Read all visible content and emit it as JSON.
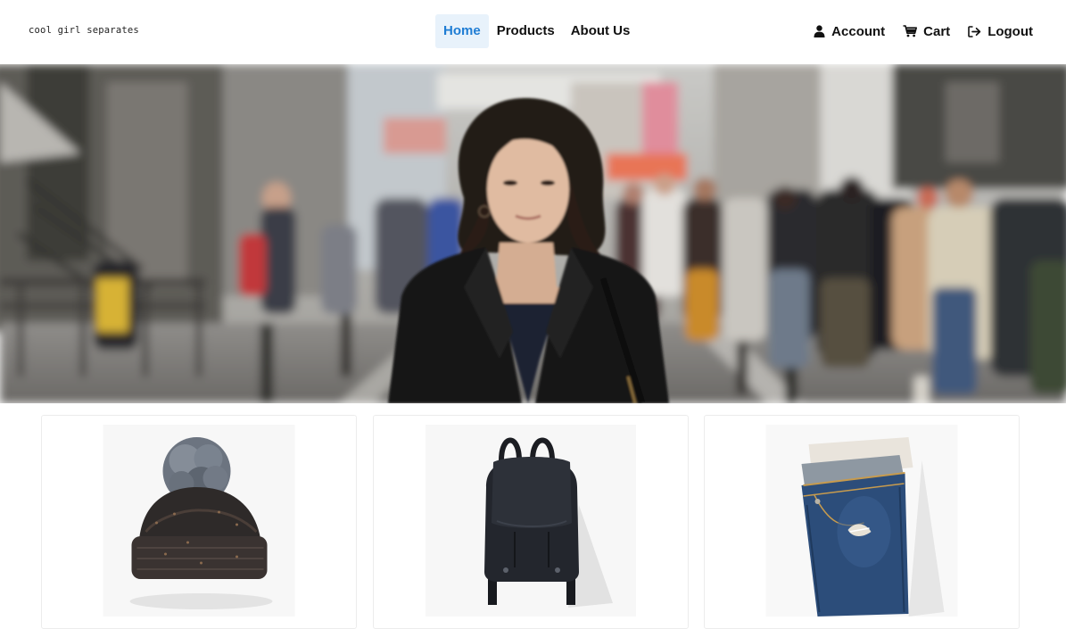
{
  "brand": {
    "name": "cool girl separates"
  },
  "nav": {
    "links": [
      {
        "label": "Home",
        "active": true
      },
      {
        "label": "Products",
        "active": false
      },
      {
        "label": "About Us",
        "active": false
      }
    ],
    "account_label": "Account",
    "cart_label": "Cart",
    "logout_label": "Logout"
  },
  "hero": {
    "image": "woman-in-black-coat-on-city-street"
  },
  "products": [
    {
      "image": "knit-beanie-with-pom-pom"
    },
    {
      "image": "black-leather-backpack"
    },
    {
      "image": "folded-ripped-denim-jeans"
    }
  ],
  "colors": {
    "active_link": "#1f7dd4",
    "active_link_bg": "#e8f2fb",
    "text": "#111111"
  }
}
